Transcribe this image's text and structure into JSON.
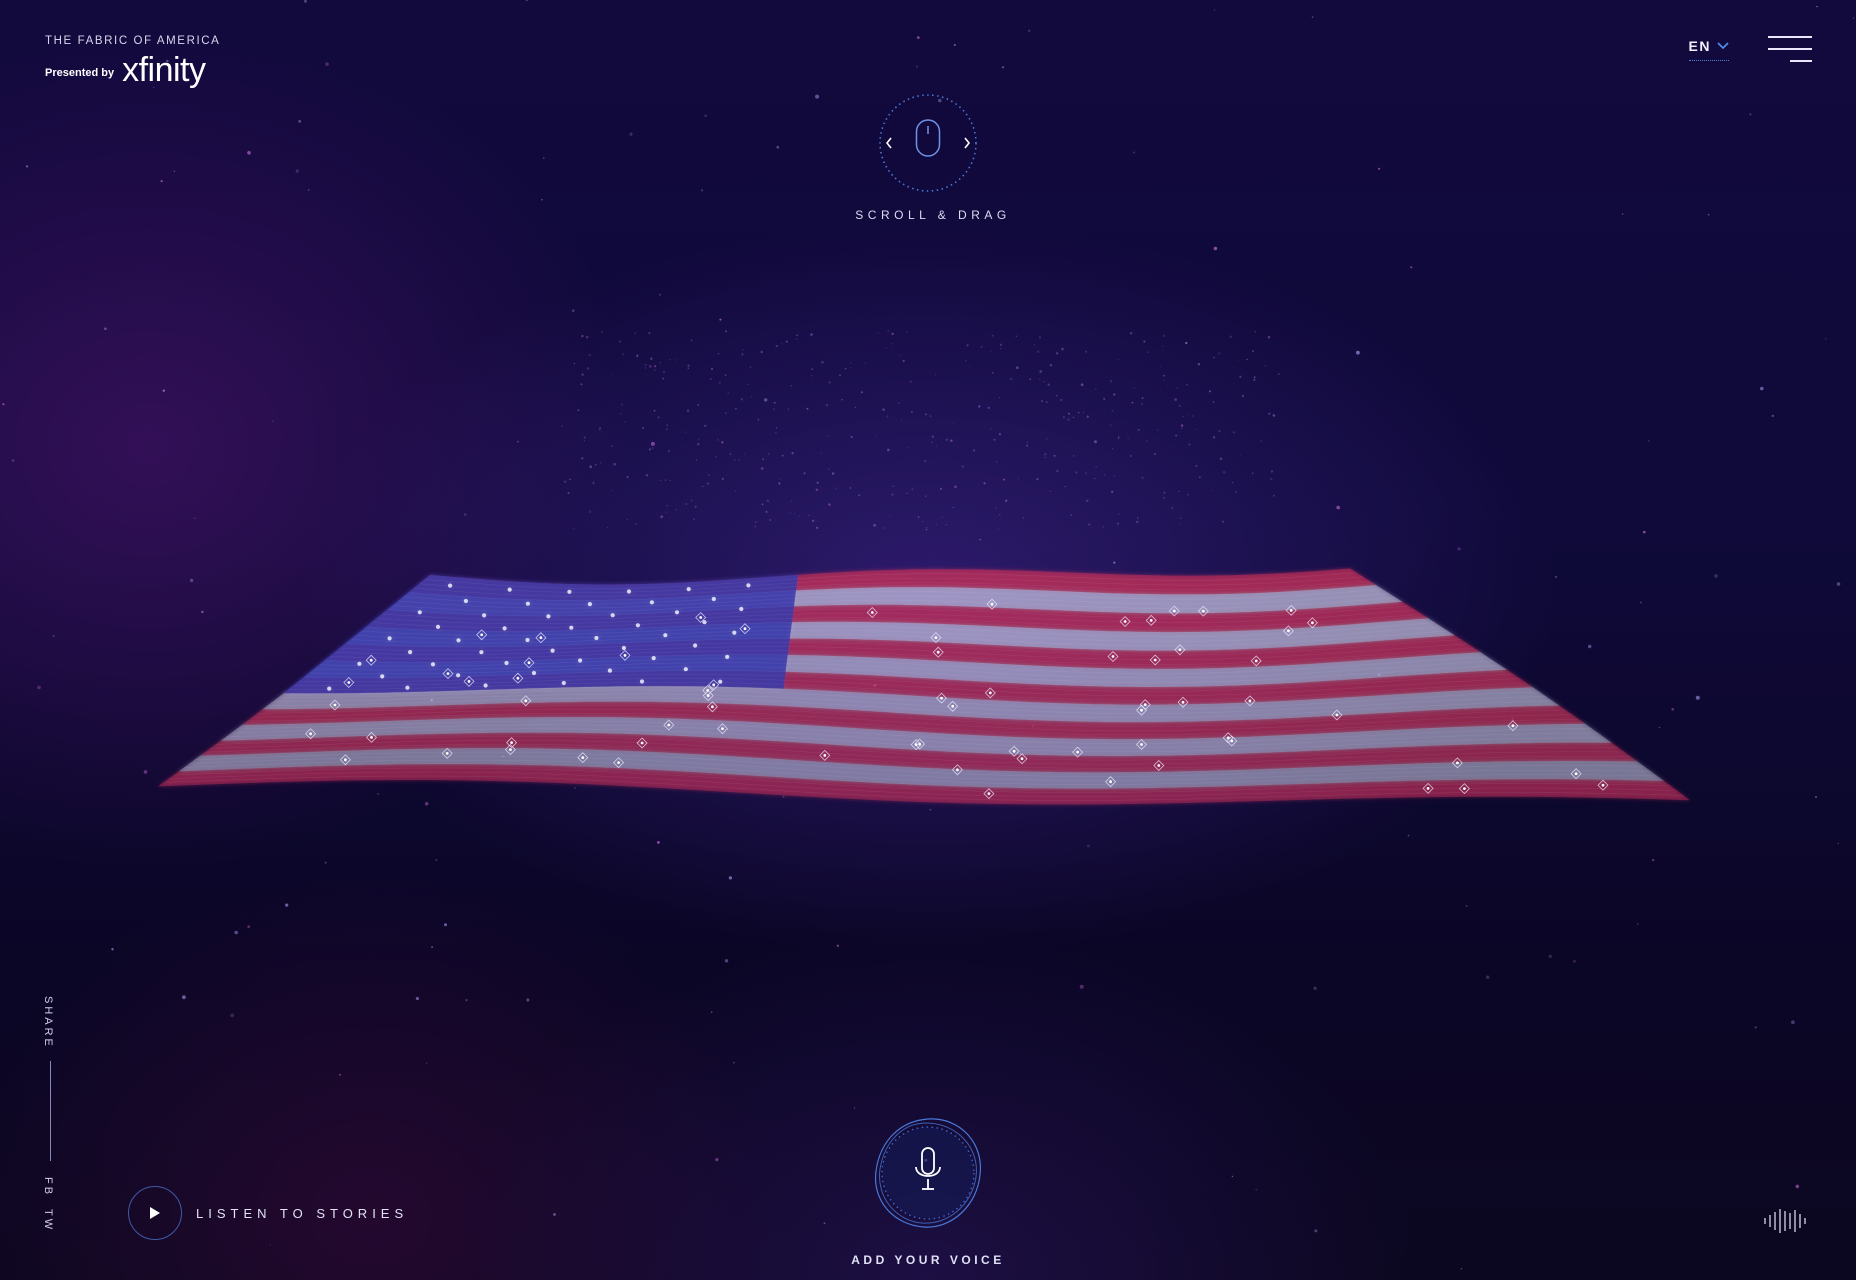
{
  "header": {
    "site_title": "THE FABRIC OF AMERICA",
    "presented_by": "Presented by",
    "sponsor_logo_text": "xfinity"
  },
  "language": {
    "current": "EN",
    "icon": "chevron-down-icon"
  },
  "menu": {
    "icon": "hamburger-menu-icon"
  },
  "hint": {
    "label": "SCROLL & DRAG",
    "icon": "mouse-icon"
  },
  "share": {
    "label": "SHARE",
    "facebook": "FB",
    "twitter": "TW"
  },
  "listen": {
    "label": "LISTEN TO STORIES",
    "icon": "play-icon"
  },
  "voice": {
    "label": "ADD YOUR VOICE",
    "icon": "microphone-icon"
  },
  "sound": {
    "icon": "sound-wave-icon"
  },
  "colors": {
    "background": "#100a38",
    "accent_blue": "#3f6fd6",
    "flag_red": "#c2305a",
    "flag_white": "#e8e6ff",
    "flag_canton": "#3a3aa8"
  }
}
